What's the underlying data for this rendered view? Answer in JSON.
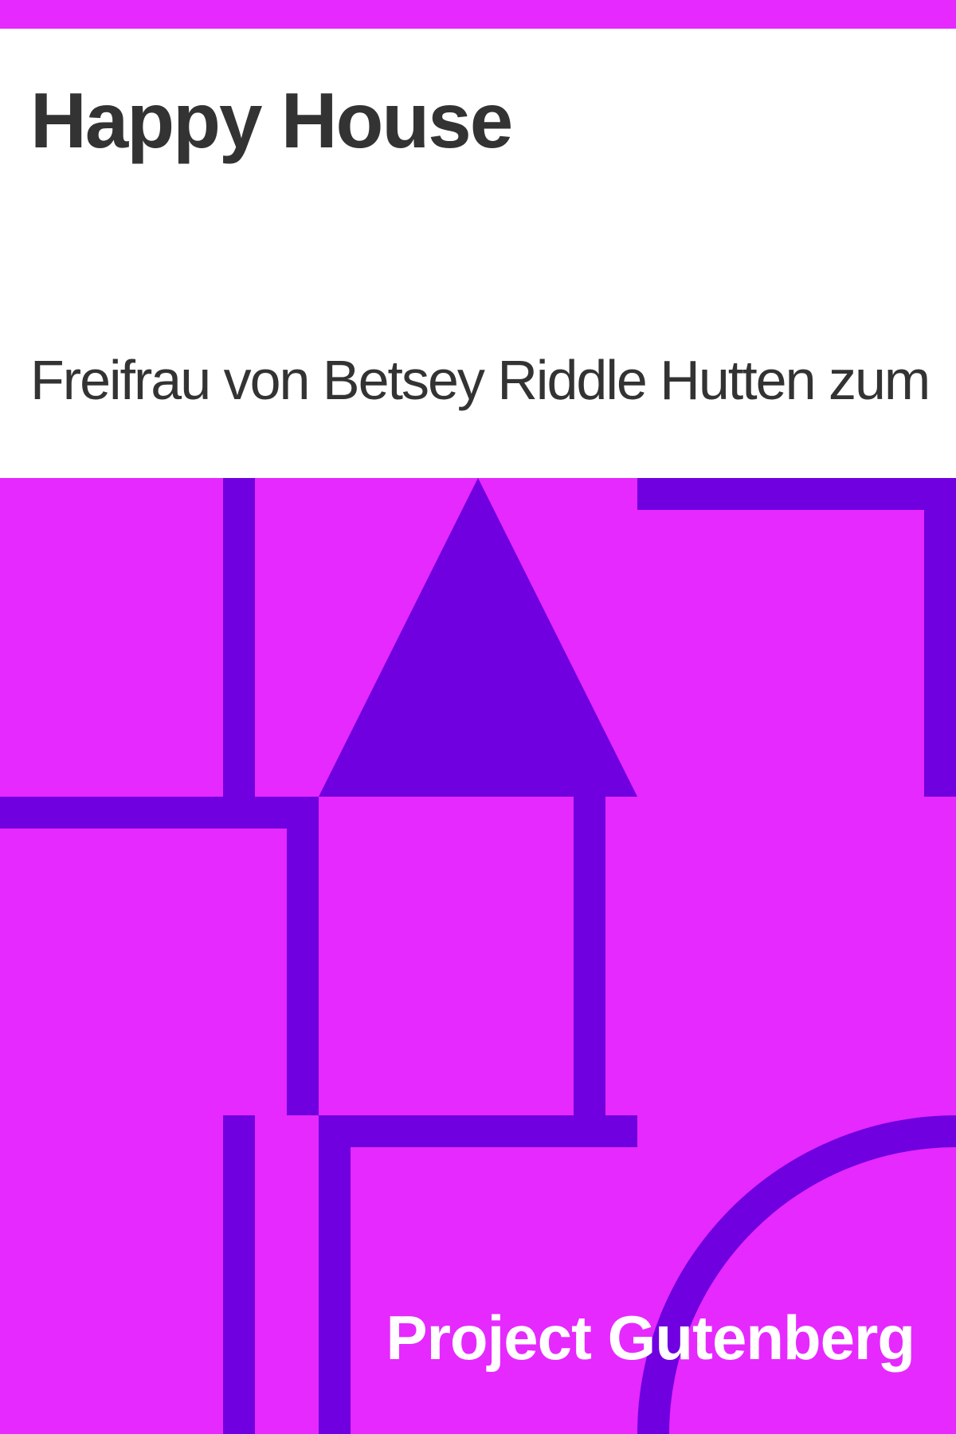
{
  "cover": {
    "title": "Happy House",
    "author": "Freifrau von Betsey Riddle Hutten zum",
    "publisher": "Project Gutenberg"
  },
  "colors": {
    "background": "#ffffff",
    "accent": "#e629fe",
    "shape": "#7000e0",
    "text": "#333333",
    "publisher_text": "#ffffff"
  }
}
